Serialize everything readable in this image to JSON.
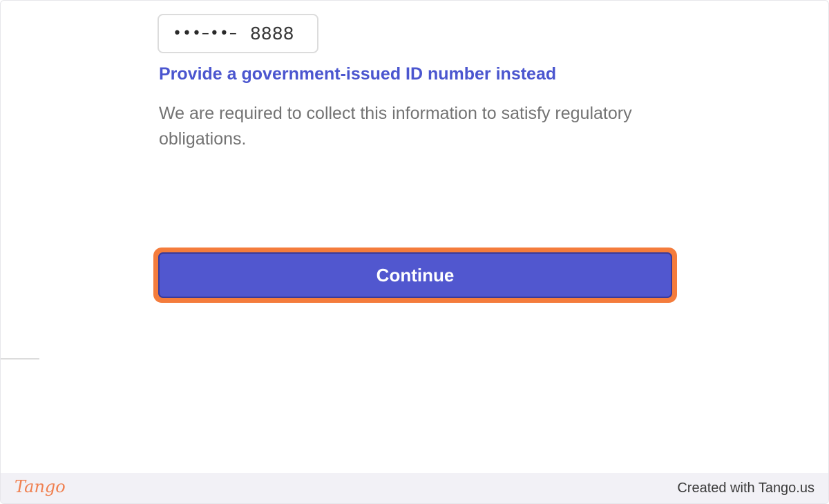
{
  "form": {
    "ssn_mask": "•••–••–",
    "ssn_last4": "8888",
    "id_link": "Provide a government-issued ID number instead",
    "note": "We are required to collect this information to satisfy regulatory obligations.",
    "continue_label": "Continue"
  },
  "footer": {
    "logo": "Tango",
    "credit": "Created with Tango.us"
  },
  "colors": {
    "primary": "#5157cf",
    "link": "#4b56cf",
    "highlight": "#f47c3c"
  }
}
